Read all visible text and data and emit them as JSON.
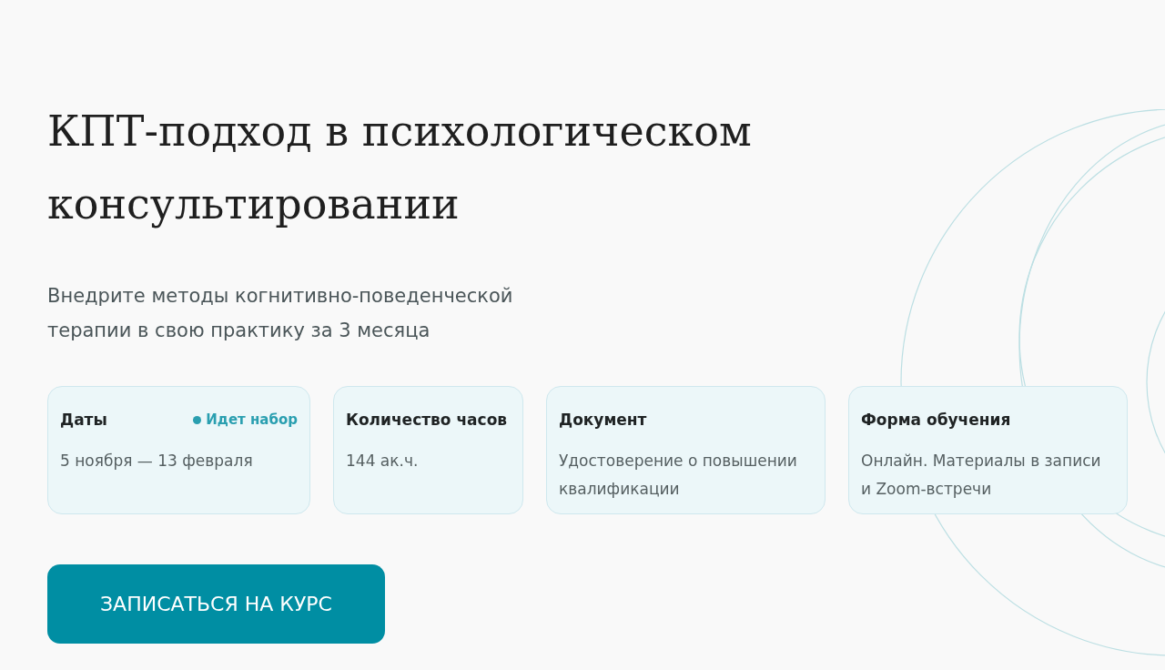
{
  "title": "КПТ-подход в психологическом консультировании",
  "subtitle": "Внедрите методы когнитивно-поведенческой терапии в свою практику за 3 месяца",
  "cards": [
    {
      "label": "Даты",
      "value": "5 ноября — 13 февраля",
      "status": "Идет набор"
    },
    {
      "label": "Количество часов",
      "value": "144 ак.ч."
    },
    {
      "label": "Документ",
      "value": "Удостоверение о повышении квалификации"
    },
    {
      "label": "Форма обучения",
      "value": "Онлайн. Материалы в записи и Zoom-встречи"
    }
  ],
  "cta_button": "ЗАПИСАТЬСЯ НА КУРС"
}
